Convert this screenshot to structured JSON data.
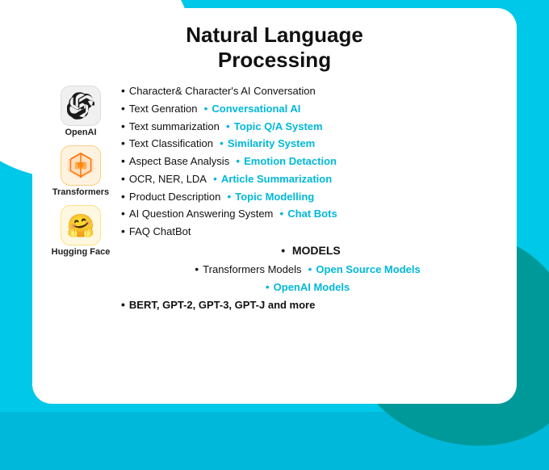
{
  "page": {
    "title_line1": "Natural Language",
    "title_line2": "Processing",
    "logos": [
      {
        "id": "openai",
        "label": "OpenAI",
        "type": "openai"
      },
      {
        "id": "transformers",
        "label": "Transformers",
        "type": "tf"
      },
      {
        "id": "huggingface",
        "label": "Hugging Face",
        "type": "hf"
      }
    ],
    "bullets_left": [
      "Character& Character's AI Conversation",
      "Text Genration",
      "Text summarization",
      "Text Classification",
      "Aspect Base Analysis",
      "OCR, NER, LDA",
      "Product Description",
      "AI Question Answering System",
      "FAQ ChatBot"
    ],
    "bullets_right": [
      "Conversational AI",
      "Topic Q/A System",
      "Similarity System",
      "Emotion Detaction",
      "Article Summarization",
      "Topic Modelling",
      "Chat Bots"
    ],
    "models_label": "MODELS",
    "models_list": [
      "Transformers Models",
      "Open Source Models",
      "OpenAI Models"
    ],
    "bottom_bold": "BERT, GPT-2, GPT-3, GPT-J and more"
  }
}
